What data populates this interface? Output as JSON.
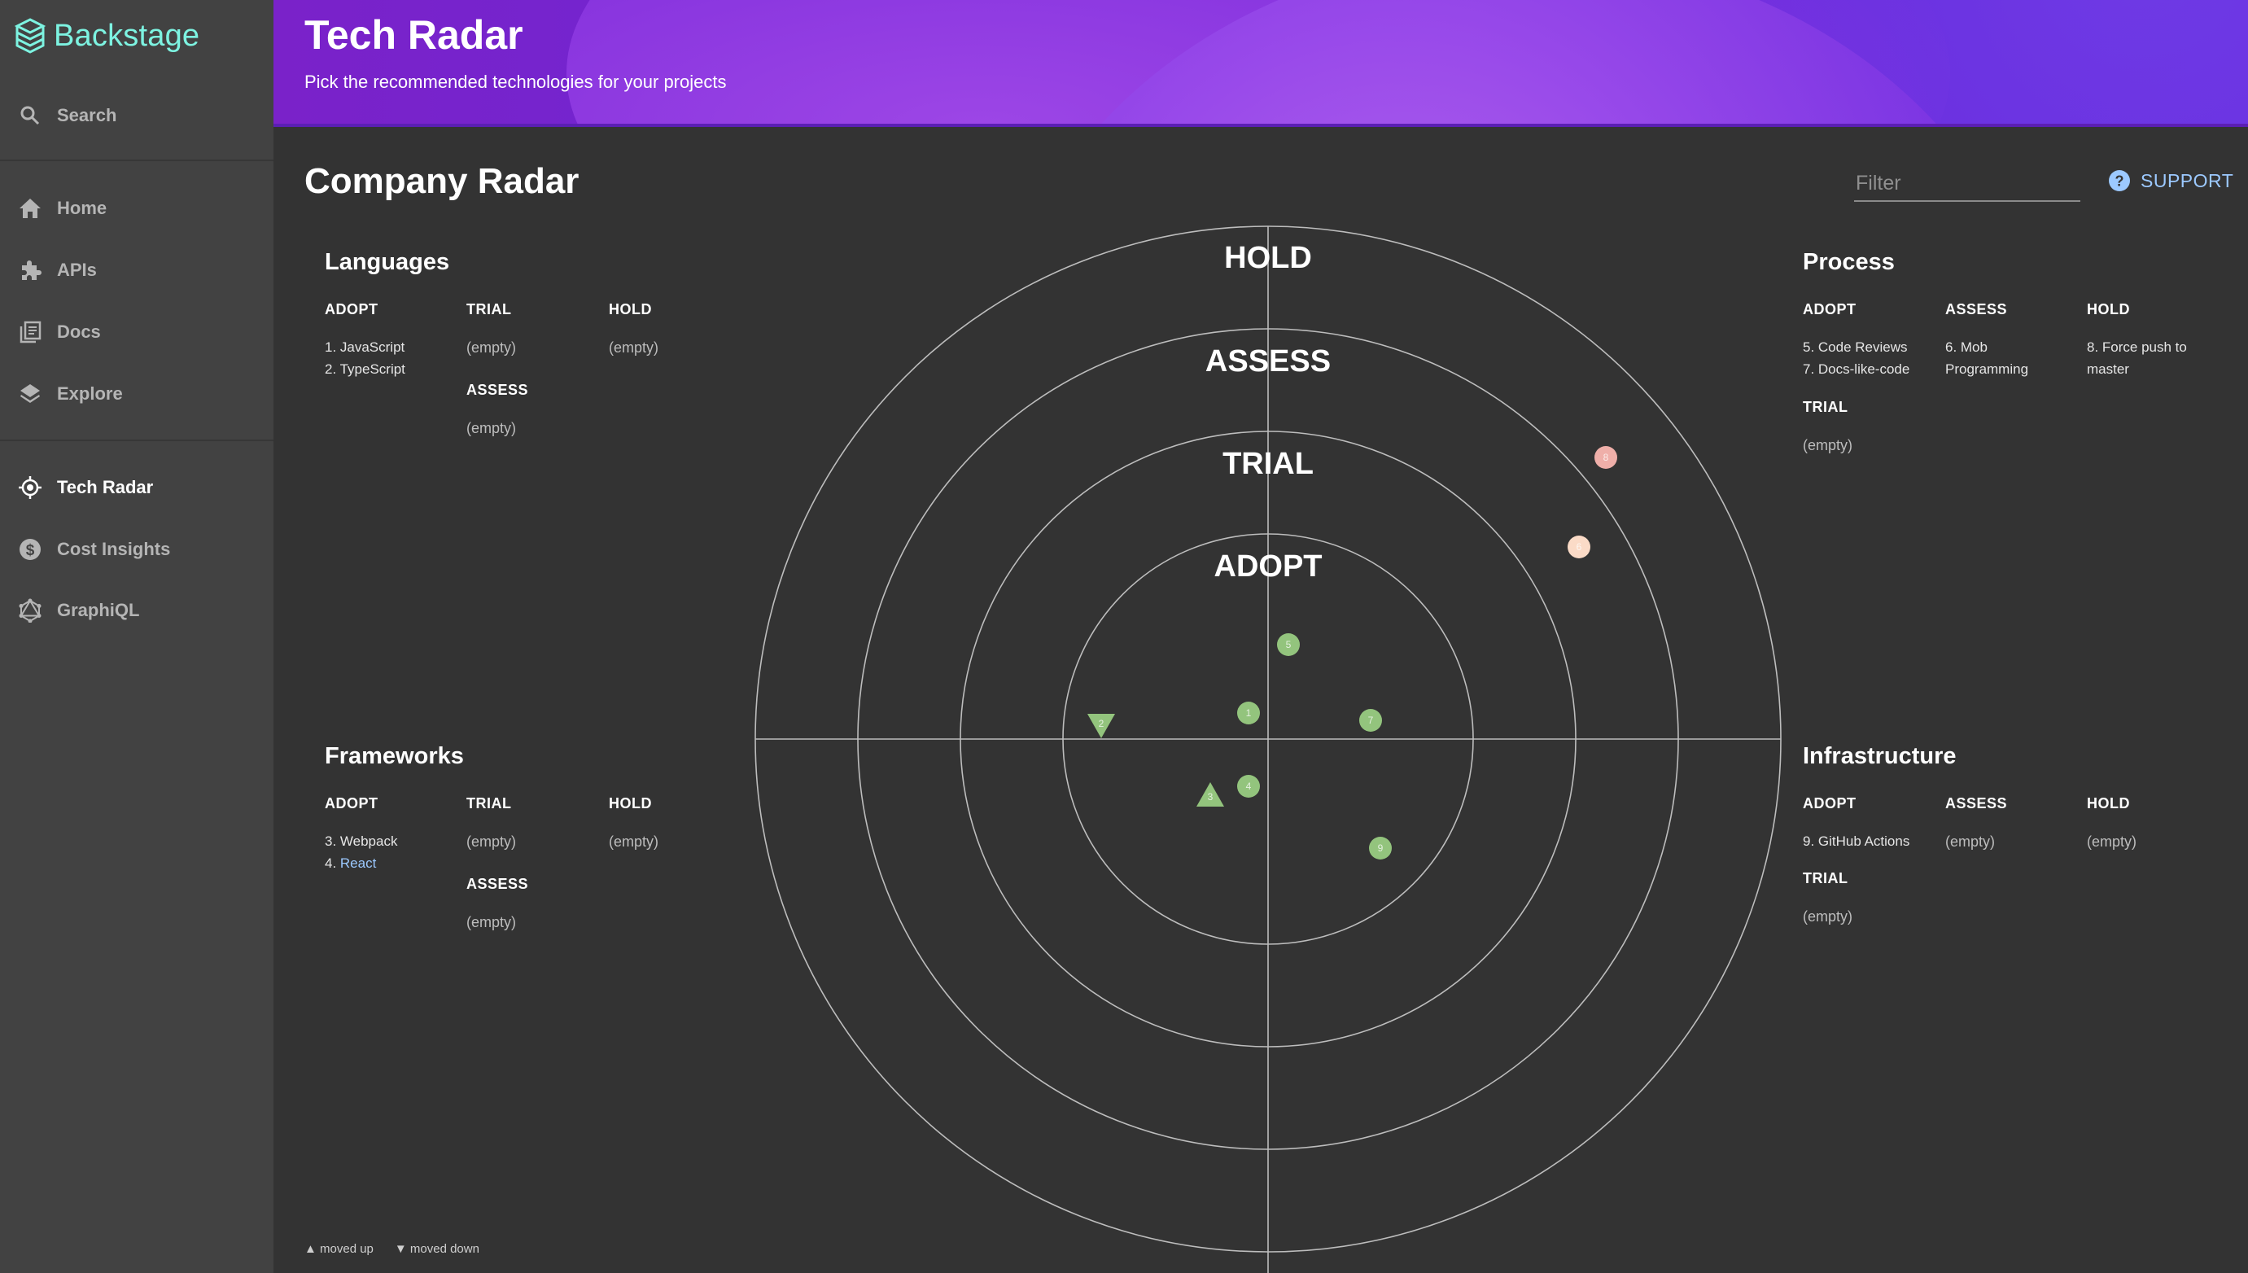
{
  "sidebar": {
    "logo_text": "Backstage",
    "search_label": "Search",
    "items": [
      {
        "label": "Home",
        "icon": "home-icon"
      },
      {
        "label": "APIs",
        "icon": "puzzle-icon"
      },
      {
        "label": "Docs",
        "icon": "library-icon"
      },
      {
        "label": "Explore",
        "icon": "layers-icon"
      },
      {
        "label": "Tech Radar",
        "icon": "radar-icon",
        "active": true
      },
      {
        "label": "Cost Insights",
        "icon": "dollar-icon"
      },
      {
        "label": "GraphiQL",
        "icon": "graphql-icon"
      }
    ]
  },
  "header": {
    "title": "Tech Radar",
    "subtitle": "Pick the recommended technologies for your projects"
  },
  "content": {
    "title": "Company Radar",
    "filter_placeholder": "Filter",
    "support_label": "SUPPORT"
  },
  "quadrants": {
    "languages": {
      "title": "Languages",
      "adopt": {
        "title": "ADOPT",
        "entries": [
          "1. JavaScript",
          "2. TypeScript"
        ]
      },
      "trial": {
        "title": "TRIAL",
        "empty": "(empty)"
      },
      "assess": {
        "title": "ASSESS",
        "empty": "(empty)"
      },
      "hold": {
        "title": "HOLD",
        "empty": "(empty)"
      }
    },
    "frameworks": {
      "title": "Frameworks",
      "adopt": {
        "title": "ADOPT",
        "entries": [
          "3. Webpack",
          "4. "
        ],
        "link": "React"
      },
      "trial": {
        "title": "TRIAL",
        "empty": "(empty)"
      },
      "assess": {
        "title": "ASSESS",
        "empty": "(empty)"
      },
      "hold": {
        "title": "HOLD",
        "empty": "(empty)"
      }
    },
    "process": {
      "title": "Process",
      "adopt": {
        "title": "ADOPT",
        "entries": [
          "5. Code Reviews",
          "7. Docs-like-code"
        ]
      },
      "assess": {
        "title": "ASSESS",
        "entries": [
          "6. Mob",
          "Programming"
        ]
      },
      "hold": {
        "title": "HOLD",
        "entries": [
          "8. Force push to",
          "master"
        ]
      },
      "trial": {
        "title": "TRIAL",
        "empty": "(empty)"
      }
    },
    "infrastructure": {
      "title": "Infrastructure",
      "adopt": {
        "title": "ADOPT",
        "entries": [
          "9. GitHub Actions"
        ]
      },
      "assess": {
        "title": "ASSESS",
        "empty": "(empty)"
      },
      "hold": {
        "title": "HOLD",
        "empty": "(empty)"
      },
      "trial": {
        "title": "TRIAL",
        "empty": "(empty)"
      }
    }
  },
  "radar": {
    "rings": [
      "ADOPT",
      "TRIAL",
      "ASSESS",
      "HOLD"
    ],
    "blips": [
      {
        "id": "1",
        "shape": "circle",
        "ring": "ADOPT",
        "color": "#93c47d"
      },
      {
        "id": "2",
        "shape": "triangle-down",
        "ring": "ADOPT",
        "color": "#93c47d"
      },
      {
        "id": "3",
        "shape": "triangle-up",
        "ring": "ADOPT",
        "color": "#93c47d"
      },
      {
        "id": "4",
        "shape": "circle",
        "ring": "ADOPT",
        "color": "#93c47d"
      },
      {
        "id": "5",
        "shape": "circle",
        "ring": "ADOPT",
        "color": "#93c47d"
      },
      {
        "id": "7",
        "shape": "circle",
        "ring": "ADOPT",
        "color": "#93c47d"
      },
      {
        "id": "9",
        "shape": "circle",
        "ring": "ADOPT",
        "color": "#93c47d"
      },
      {
        "id": "6",
        "shape": "circle",
        "ring": "ASSESS",
        "color": "#fbdbc7"
      },
      {
        "id": "8",
        "shape": "circle",
        "ring": "HOLD",
        "color": "#efafa9"
      }
    ]
  },
  "legend": {
    "moved_up": "▲ moved up",
    "moved_down": "▼ moved down"
  },
  "colors": {
    "accent": "#7df3e1",
    "link": "#9cc9ff",
    "background": "#333333",
    "sidebar": "#424242"
  }
}
